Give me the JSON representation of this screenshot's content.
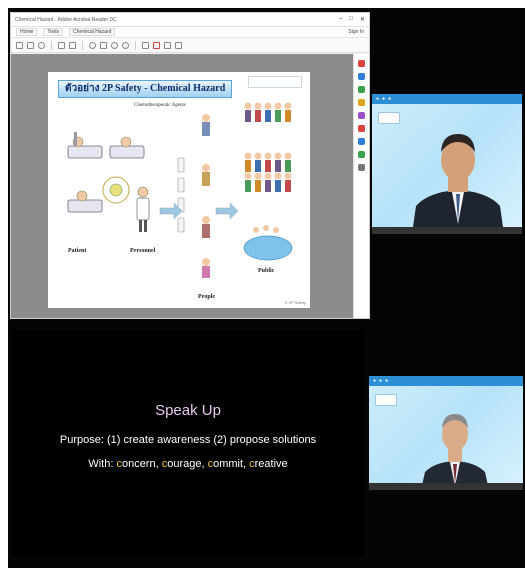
{
  "viewer": {
    "window_title": "Chemical Hazard - Adobe Acrobat Reader DC",
    "menu_tabs": [
      "Home",
      "Tools",
      "Chemical Hazard"
    ],
    "menu_right": [
      "Sign In"
    ],
    "window_buttons": [
      "–",
      "□",
      "✕"
    ]
  },
  "slide": {
    "title": "ตัวอย่าง 2P Safety - Chemical Hazard",
    "agent_label": "Chemotherapeutic Agents",
    "labels": {
      "patient": "Patient",
      "personnel": "Personnel",
      "people": "People",
      "public": "Public"
    },
    "copyright": "© 2P Safety"
  },
  "speakup": {
    "title": "Speak Up",
    "purpose": "Purpose: (1) create awareness (2) propose solutions",
    "with_prefix": "With: ",
    "items": [
      {
        "first": "c",
        "rest": "oncern, "
      },
      {
        "first": "c",
        "rest": "ourage, "
      },
      {
        "first": "c",
        "rest": "ommit, "
      },
      {
        "first": "c",
        "rest": "reative"
      }
    ]
  },
  "colors": {
    "speak_title": "#e7c8ef",
    "highlight": "#f1c232",
    "tile_banner": "#2d8fd6"
  }
}
